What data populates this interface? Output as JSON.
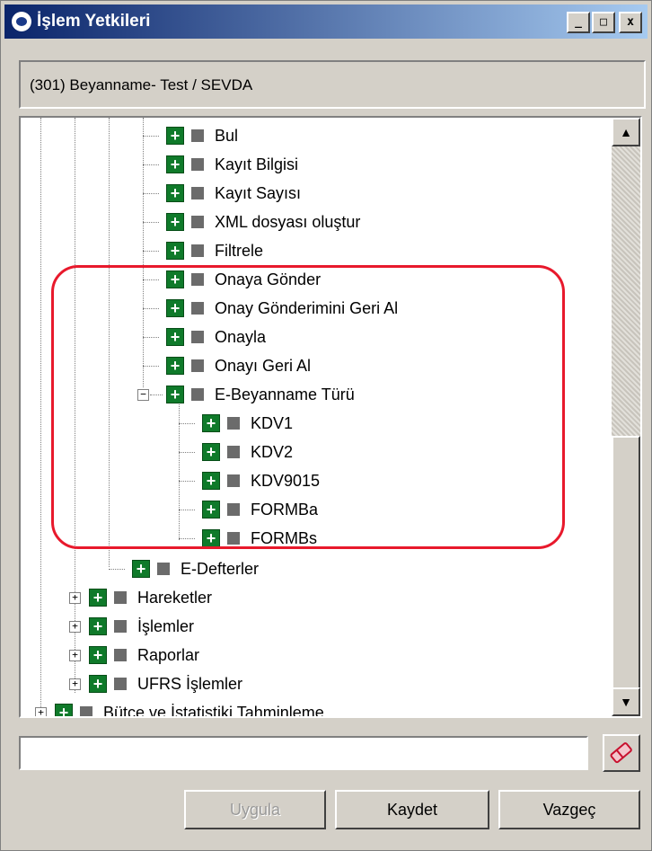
{
  "window": {
    "title": "İşlem Yetkileri",
    "minimize_glyph": "_",
    "maximize_glyph": "□",
    "close_glyph": "x"
  },
  "header": {
    "text": "(301) Beyanname- Test / SEVDA"
  },
  "tree": {
    "items": [
      {
        "label": "Bul"
      },
      {
        "label": "Kayıt Bilgisi"
      },
      {
        "label": "Kayıt Sayısı"
      },
      {
        "label": "XML dosyası oluştur"
      },
      {
        "label": "Filtrele"
      },
      {
        "label": "Onaya Gönder"
      },
      {
        "label": "Onay Gönderimini Geri Al"
      },
      {
        "label": "Onayla"
      },
      {
        "label": "Onayı Geri Al"
      },
      {
        "label": "E-Beyanname Türü",
        "expanded": true
      },
      {
        "label": "KDV1"
      },
      {
        "label": "KDV2"
      },
      {
        "label": "KDV9015"
      },
      {
        "label": "FORMBa"
      },
      {
        "label": "FORMBs"
      },
      {
        "label": "E-Defterler"
      },
      {
        "label": "Hareketler",
        "expanded": false
      },
      {
        "label": "İşlemler",
        "expanded": false
      },
      {
        "label": "Raporlar",
        "expanded": false
      },
      {
        "label": "UFRS İşlemler",
        "expanded": false
      },
      {
        "label": "Bütçe ve İstatistiki Tahminleme",
        "expanded": false
      }
    ],
    "expand_glyph": "+",
    "collapse_glyph": "−",
    "scroll_up_glyph": "▲",
    "scroll_down_glyph": "▼"
  },
  "footer": {
    "input_value": "",
    "apply_label": "Uygula",
    "save_label": "Kaydet",
    "cancel_label": "Vazgeç"
  },
  "colors": {
    "title_start": "#0a246a",
    "title_end": "#a6caf0",
    "permission_icon": "#0f7a2a",
    "highlight": "#e8192c"
  }
}
